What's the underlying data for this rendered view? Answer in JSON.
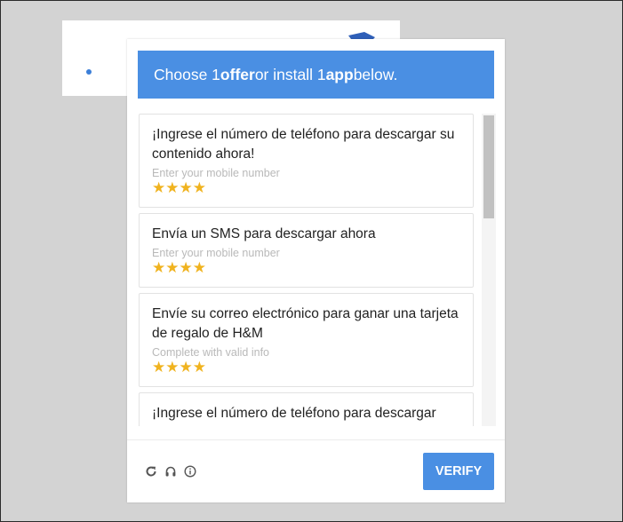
{
  "header": {
    "prefix": "Choose 1 ",
    "offer_word": "offer",
    "middle": " or install 1 ",
    "app_word": "app",
    "suffix": " below."
  },
  "offers": [
    {
      "title": "¡Ingrese el número de teléfono para descargar su contenido ahora!",
      "subtitle": "Enter your mobile number",
      "stars": "★★★★"
    },
    {
      "title": "Envía un SMS para descargar ahora",
      "subtitle": "Enter your mobile number",
      "stars": "★★★★"
    },
    {
      "title": "Envíe su correo electrónico para ganar una tarjeta de regalo de H&M",
      "subtitle": "Complete with valid info",
      "stars": "★★★★"
    },
    {
      "title": "¡Ingrese el número de teléfono para descargar",
      "subtitle": "",
      "stars": ""
    }
  ],
  "footer": {
    "verify_label": "VERIFY",
    "icons": [
      "refresh-icon",
      "headphones-icon",
      "info-icon"
    ]
  },
  "colors": {
    "accent": "#4a8fe3",
    "stars": "#f0b31f",
    "backdrop": "#d3d3d3"
  }
}
